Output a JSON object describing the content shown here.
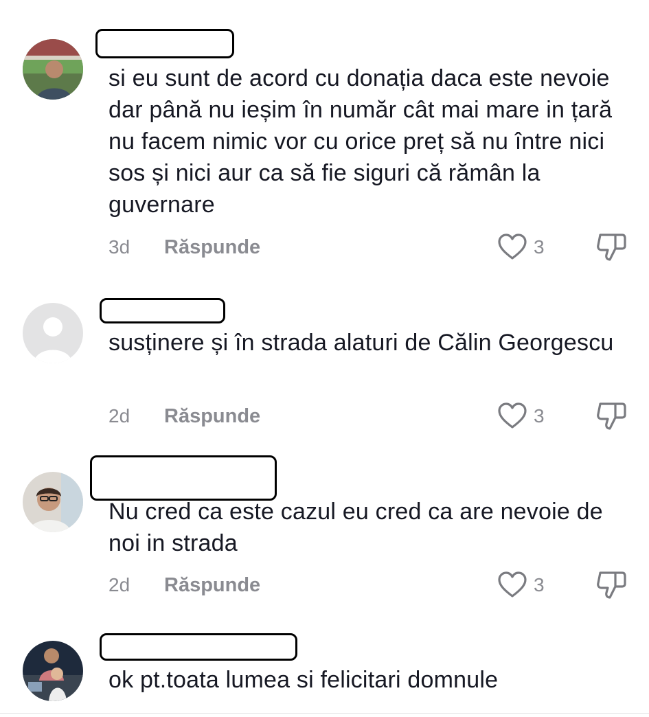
{
  "comments": [
    {
      "text": "si eu sunt de acord cu donația daca este nevoie dar până nu ieșim în număr cât mai mare in țară nu facem nimic vor cu orice preț să nu între nici sos și nici aur ca să fie siguri că rămân la guvernare",
      "time": "3d",
      "reply": "Răspunde",
      "likes": "3"
    },
    {
      "text": "susținere și în strada alaturi de Călin Georgescu",
      "time": "2d",
      "reply": "Răspunde",
      "likes": "3"
    },
    {
      "text": "Nu cred ca este cazul eu cred ca are nevoie de noi in strada",
      "time": "2d",
      "reply": "Răspunde",
      "likes": "3"
    },
    {
      "text": "ok pt.toata lumea si felicitari domnule"
    }
  ],
  "colors": {
    "text": "#161823",
    "meta": "#8a8b91",
    "icon": "#7a7b80"
  },
  "icons": [
    "user-avatar",
    "default-avatar-icon",
    "heart-icon",
    "dislike-icon"
  ]
}
